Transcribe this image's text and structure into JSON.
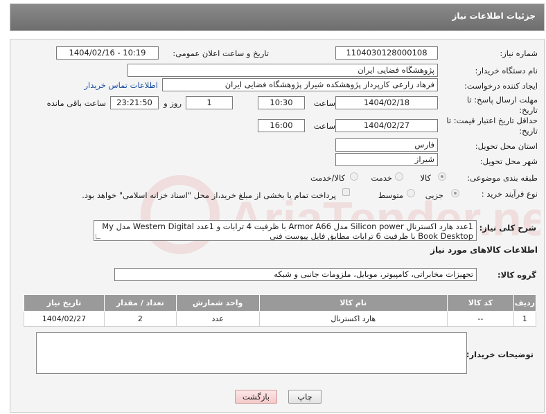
{
  "header": {
    "title": "جزئیات اطلاعات نیاز"
  },
  "fields": {
    "need_number_label": "شماره نیاز:",
    "need_number": "1104030128000108",
    "announce_label": "تاریخ و ساعت اعلان عمومی:",
    "announce_value": "1404/02/16 - 10:19",
    "buyer_org_label": "نام دستگاه خریدار:",
    "buyer_org": "پژوهشگاه فضایی ایران",
    "requester_label": "ایجاد کننده درخواست:",
    "requester": "فرهاد زارعی کارپرداز پژوهشکده شیراز پژوهشگاه فضایی ایران",
    "contact_link": "اطلاعات تماس خریدار",
    "deadline_label": "مهلت ارسال پاسخ: تا تاریخ:",
    "deadline_date": "1404/02/18",
    "time_label": "ساعت",
    "deadline_time": "10:30",
    "days_value": "1",
    "days_label": "روز و",
    "remaining_time": "23:21:50",
    "remaining_label": "ساعت باقی مانده",
    "validity_label": "حداقل تاریخ اعتبار قیمت: تا تاریخ:",
    "validity_date": "1404/02/27",
    "validity_time": "16:00",
    "province_label": "استان محل تحویل:",
    "province": "فارس",
    "city_label": "شهر محل تحویل:",
    "city": "شیراز",
    "category_label": "طبقه بندی موضوعی:",
    "category_options": [
      "کالا",
      "خدمت",
      "کالا/خدمت"
    ],
    "process_label": "نوع فرآیند خرید :",
    "process_options": [
      "جزیی",
      "متوسط"
    ],
    "payment_note": "پرداخت تمام یا بخشی از مبلغ خرید،از محل \"اسناد خزانه اسلامی\" خواهد بود.",
    "summary_label": "شرح کلی نیاز:",
    "summary_text": "1عدد هارد اکسترنال Silicon power مدل Armor A66 با ظرفیت 4 ترابات و 1عدد Western Digital مدل My Book Desktop با ظرفیت 6 ترابات مطابق فایل پیوست فنی",
    "goods_info_title": "اطلاعات کالاهای مورد نیاز",
    "goods_group_label": "گروه کالا:",
    "goods_group": "تجهیزات مخابراتی، کامپیوتر، موبایل، ملزومات جانبی و شبکه"
  },
  "table": {
    "headers": [
      "ردیف",
      "کد کالا",
      "نام کالا",
      "واحد شمارش",
      "تعداد / مقدار",
      "تاریخ نیاز"
    ],
    "rows": [
      [
        "1",
        "--",
        "هارد اکسترنال",
        "عدد",
        "2",
        "1404/02/27"
      ]
    ]
  },
  "notes_label": "توضیحات خریدار:",
  "buttons": {
    "print": "چاپ",
    "back": "بازگشت"
  },
  "watermark_text": "AriaTender.neT"
}
